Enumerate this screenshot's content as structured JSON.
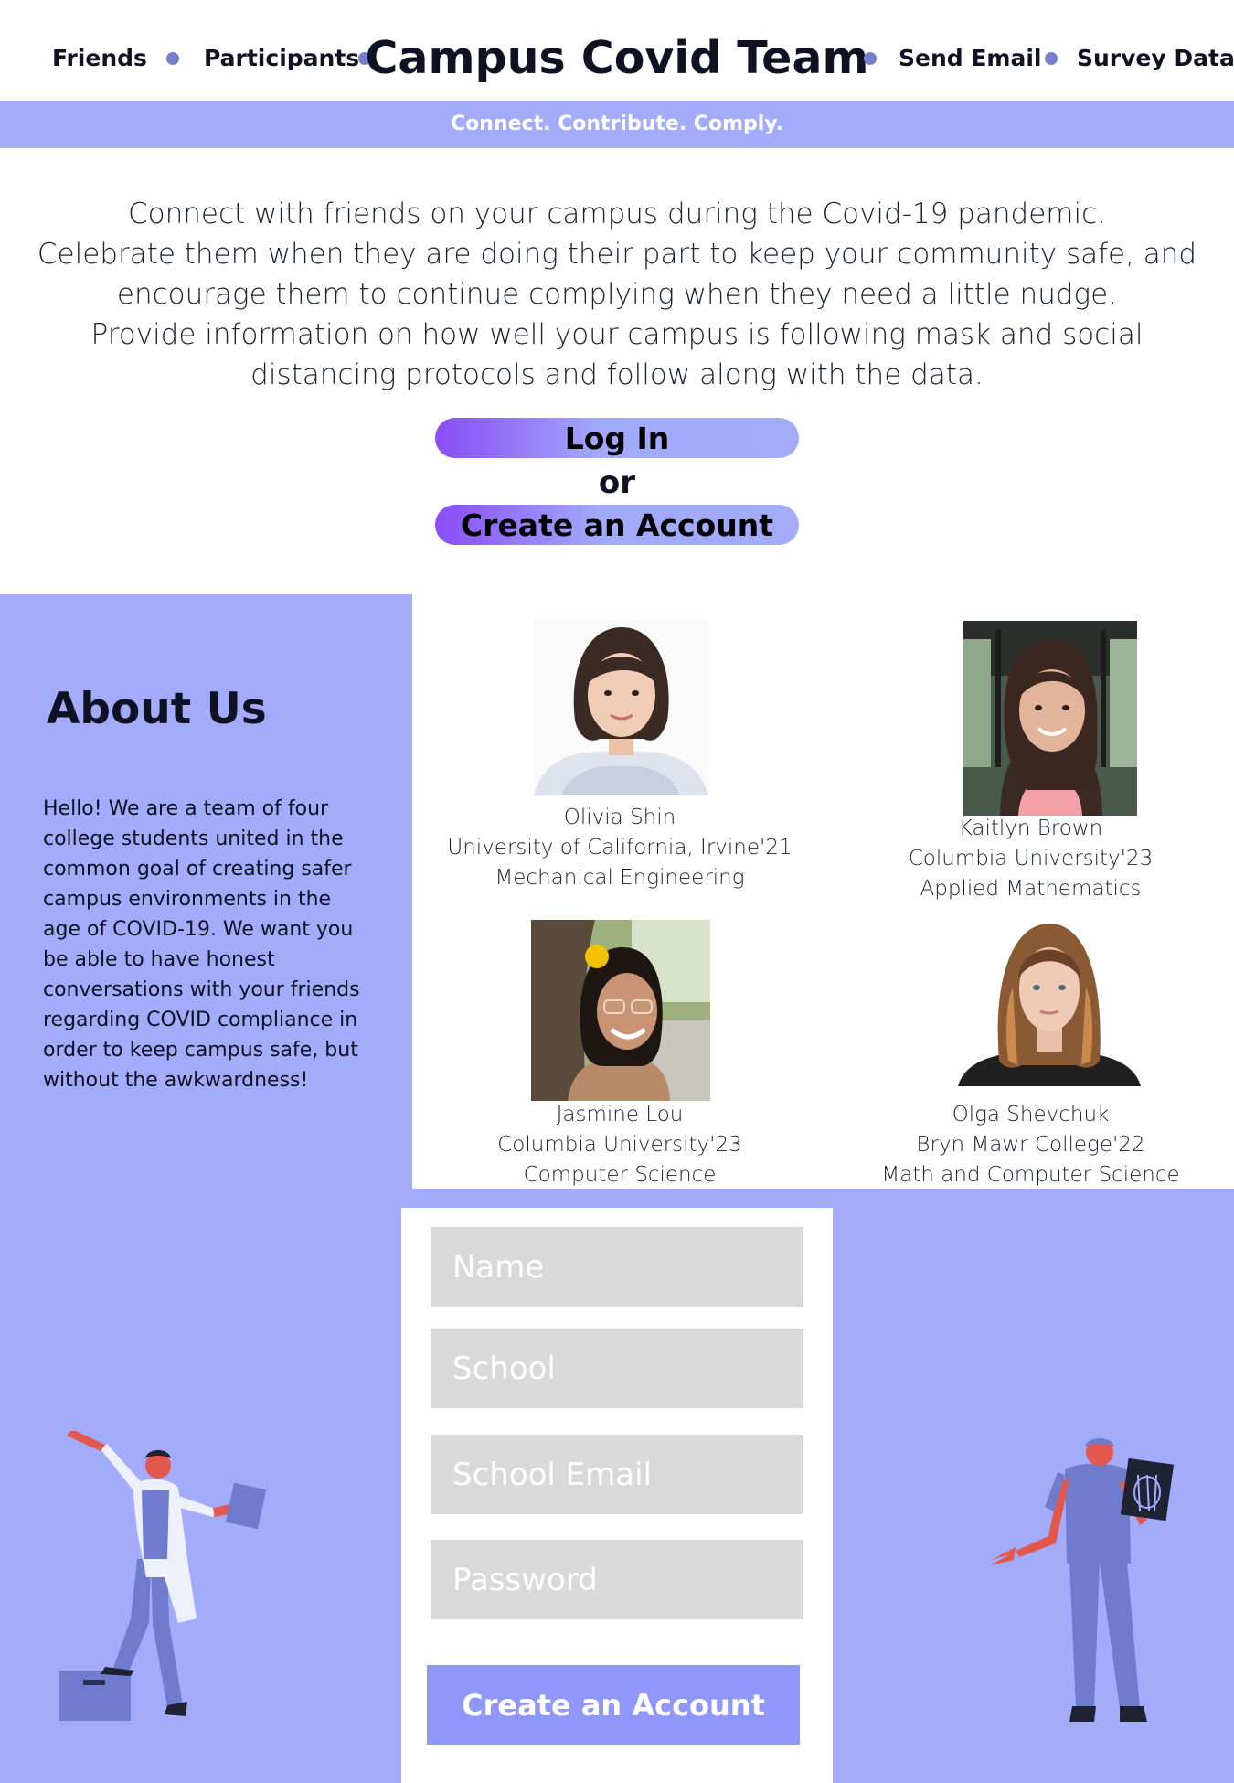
{
  "header": {
    "nav_left": [
      "Friends",
      "Participants"
    ],
    "title": "Campus Covid Team",
    "nav_right": [
      "Send Email",
      "Survey Data"
    ],
    "tagline": "Connect. Contribute. Comply."
  },
  "intro": {
    "paragraph_1": "Connect with friends on your campus during the Covid-19 pandemic.",
    "paragraph_2": "Celebrate them when they are doing their part to keep your community safe, and encourage them to continue complying when they need a little nudge.",
    "paragraph_3": "Provide information on how well your campus is following mask and social distancing protocols and follow along with the data."
  },
  "cta": {
    "login_label": "Log In",
    "or_label": "or",
    "create_label": "Create an Account"
  },
  "about": {
    "title": "About Us",
    "text": "Hello! We are a team of four college students united in the common goal of creating safer campus environments in the age of COVID-19. We want you be able to have honest conversations with your friends regarding COVID compliance in order to keep campus safe, but without the awkwardness!"
  },
  "team": [
    {
      "name": "Olivia Shin",
      "school": "University of California, Irvine'21",
      "major": "Mechanical Engineering"
    },
    {
      "name": "Kaitlyn Brown",
      "school": "Columbia University'23",
      "major": "Applied Mathematics"
    },
    {
      "name": "Jasmine Lou",
      "school": "Columbia University'23",
      "major": "Computer Science"
    },
    {
      "name": "Olga Shevchuk",
      "school": "Bryn Mawr College'22",
      "major": "Math and Computer Science"
    }
  ],
  "form": {
    "name_placeholder": "Name",
    "school_placeholder": "School",
    "email_placeholder": "School Email",
    "password_placeholder": "Password",
    "submit_label": "Create an Account"
  },
  "colors": {
    "accent": "#a3abfb",
    "nav_dot": "#7580cf",
    "gradient_start": "#8a4cf5",
    "field_bg": "#d9d9d9",
    "submit_bg": "#8f97fa"
  }
}
